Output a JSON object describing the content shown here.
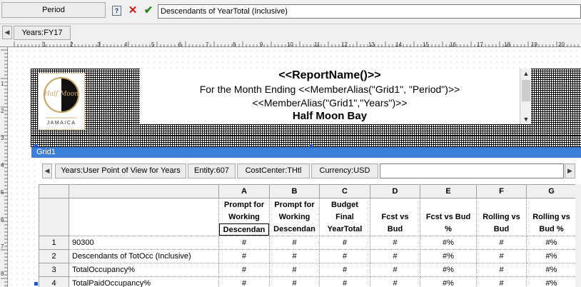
{
  "formula_bar": {
    "cell_name": "Period",
    "formula_value": "Descendants of YearTotal (Inclusive)"
  },
  "page_pov": {
    "years": "Years:FY17"
  },
  "ruler": {
    "numbers": [
      "1",
      "2",
      "3",
      "4",
      "5",
      "6",
      "7",
      "8",
      "9",
      "10",
      "11",
      "12",
      "13",
      "14",
      "15",
      "16",
      "17",
      "18",
      "19",
      "20"
    ],
    "vnumbers": [
      "1",
      "2",
      "3",
      "4",
      "5",
      "6",
      "7",
      "8"
    ]
  },
  "header": {
    "logo_text": "Half Moon",
    "logo_subtext": "JAMAICA",
    "line1": "<<ReportName()>>",
    "line2": "For the Month Ending <<MemberAlias(\"Grid1\", \"Period\")>>",
    "line3": "<<MemberAlias(\"Grid1\",\"Years\")>>",
    "line4": "Half Moon Bay"
  },
  "grid": {
    "title": "Grid1",
    "pov": {
      "years": "Years:User Point of View for Years",
      "entity": "Entity:607",
      "costcenter": "CostCenter:THtl",
      "currency": "Currency:USD"
    },
    "columns": [
      {
        "letter": "A",
        "lines": [
          "Prompt for",
          "Working",
          "Descendan"
        ]
      },
      {
        "letter": "B",
        "lines": [
          "Prompt for",
          "Working",
          "Descendan"
        ]
      },
      {
        "letter": "C",
        "lines": [
          "Budget",
          "Final",
          "YearTotal"
        ]
      },
      {
        "letter": "D",
        "lines": [
          "",
          "Fcst vs",
          "Bud"
        ]
      },
      {
        "letter": "E",
        "lines": [
          "",
          "Fcst vs Bud",
          "%"
        ]
      },
      {
        "letter": "F",
        "lines": [
          "",
          "Rolling vs",
          "Bud"
        ]
      },
      {
        "letter": "G",
        "lines": [
          "",
          "Rolling vs",
          "Bud %"
        ]
      }
    ],
    "rows": [
      {
        "num": "1",
        "label": "90300",
        "values": [
          "#",
          "#",
          "#",
          "#",
          "#%",
          "#",
          "#%"
        ]
      },
      {
        "num": "2",
        "label": "Descendants of TotOcc (Inclusive)",
        "values": [
          "#",
          "#",
          "#",
          "#",
          "#%",
          "#",
          "#%"
        ]
      },
      {
        "num": "3",
        "label": "TotalOccupancy%",
        "values": [
          "#",
          "#",
          "#",
          "#",
          "#%",
          "#",
          "#%"
        ]
      },
      {
        "num": "4",
        "label": "TotalPaidOccupancy%",
        "values": [
          "#",
          "#",
          "#",
          "#",
          "#%",
          "#",
          "#%"
        ]
      }
    ]
  },
  "colors": {
    "grid_title_bg": "#3c7fd6",
    "cancel": "#d01818",
    "accept": "#1f8a1f",
    "handle": "#2356c7"
  },
  "icons": {
    "help": "help-icon",
    "cancel": "cancel-x-icon",
    "accept": "checkmark-icon"
  }
}
